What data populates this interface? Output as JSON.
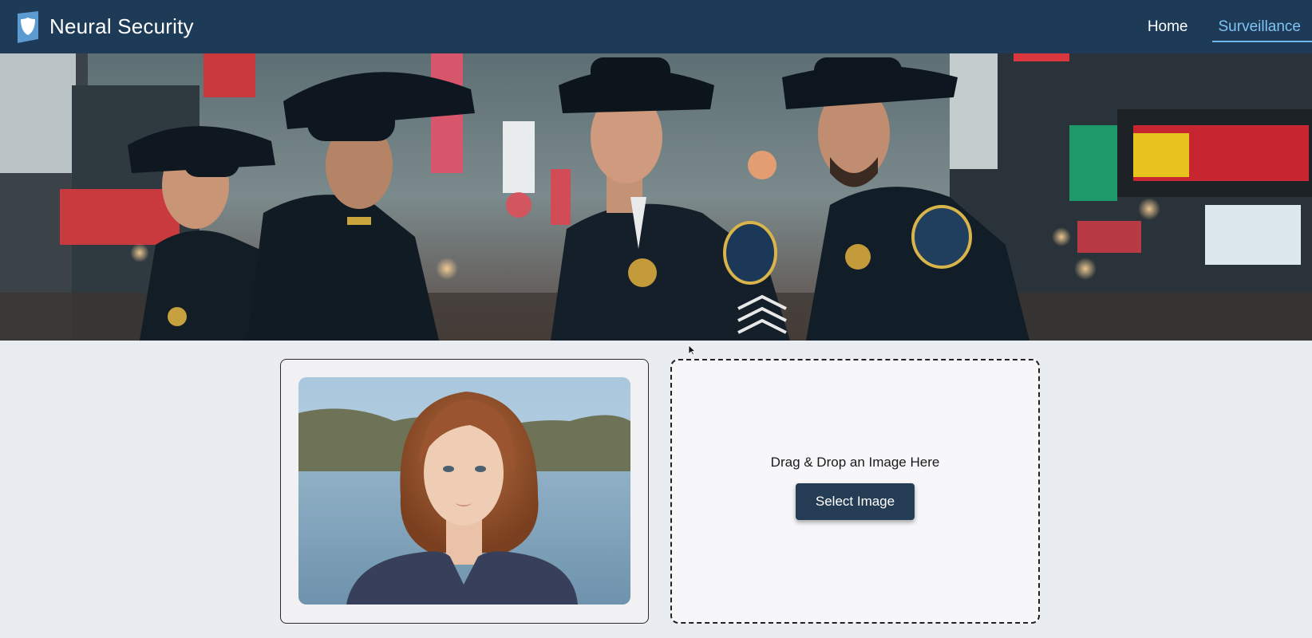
{
  "app": {
    "brand_name": "Neural Security"
  },
  "nav": {
    "items": [
      {
        "label": "Home",
        "active": false
      },
      {
        "label": "Surveillance",
        "active": true
      }
    ]
  },
  "upload": {
    "drop_text": "Drag & Drop an Image Here",
    "select_button_label": "Select Image"
  },
  "icons": {
    "logo": "shield-logo-icon",
    "cursor": "mouse-pointer-icon"
  },
  "colors": {
    "header_bg": "#1d3a57",
    "nav_active": "#7fc3f2",
    "button_bg": "#243d55",
    "page_bg": "#e9edf1"
  }
}
